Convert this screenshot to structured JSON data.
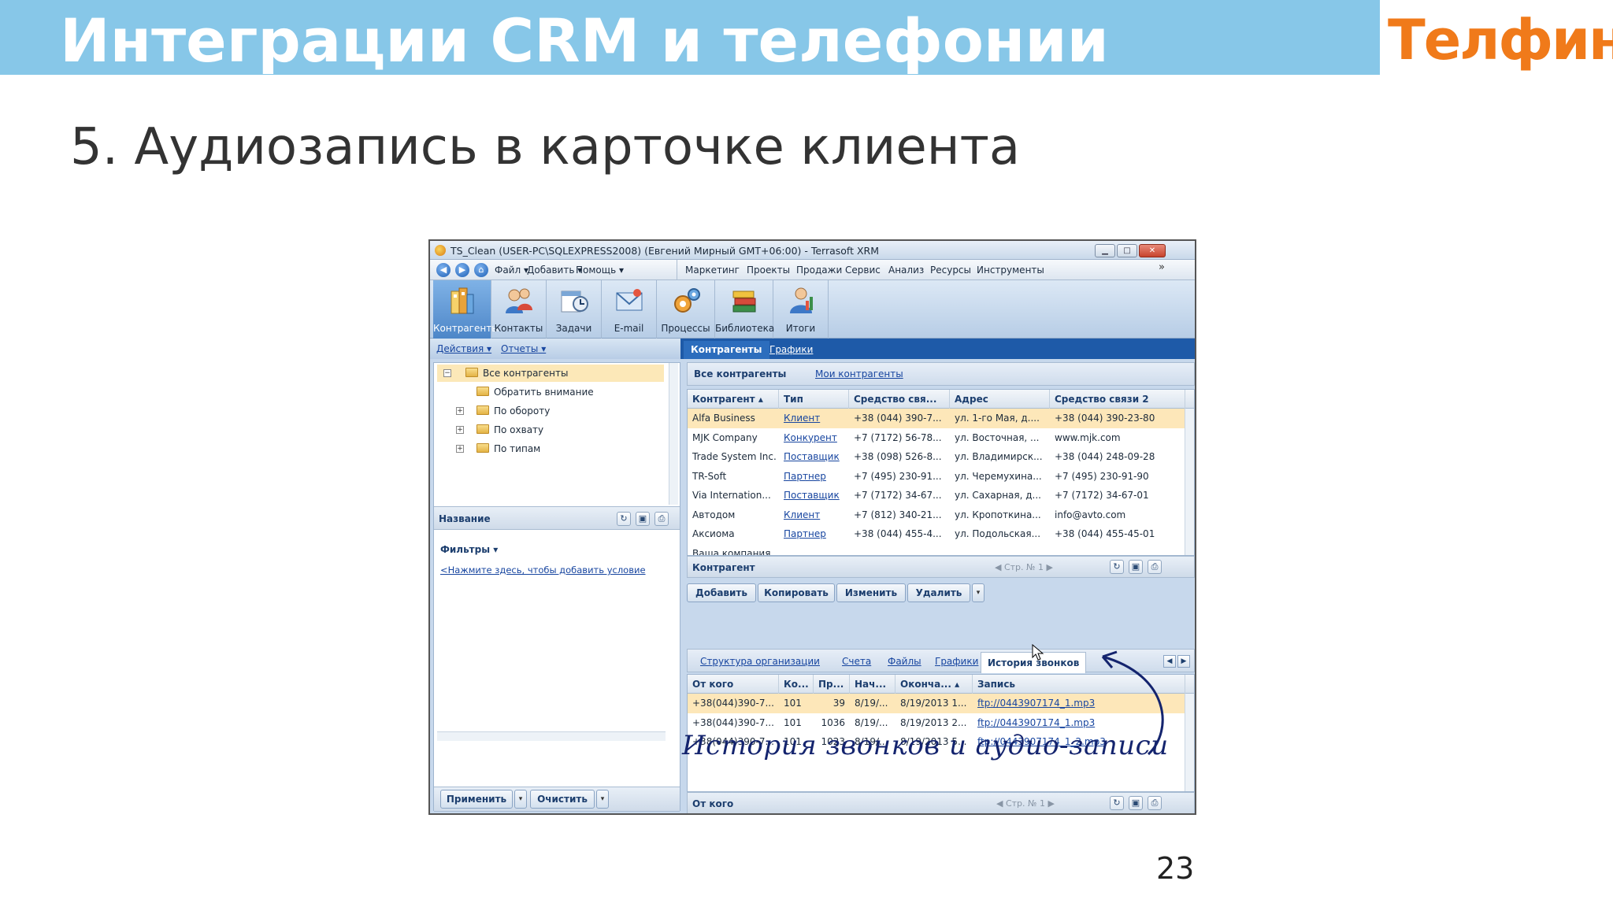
{
  "slide": {
    "banner_title": "Интеграции CRM и телефонии",
    "logo_text": "Телфин",
    "heading": "5. Аудиозапись в карточке клиента",
    "page_number": "23",
    "handwritten_note": "История звонков и аудио-записи",
    "colors": {
      "banner": "#87c7e8",
      "logo": "#f07a1a",
      "annotation": "#14246e"
    }
  },
  "window": {
    "title": "TS_Clean (USER-PC\\SQLEXPRESS2008) (Евгений Мирный GMT+06:00) - Terrasoft XRM",
    "controls": [
      "minimize",
      "maximize",
      "close"
    ]
  },
  "menu": {
    "nav_icons": [
      "back-icon",
      "forward-icon",
      "home-icon"
    ],
    "left_items": [
      "Файл",
      "Добавить",
      "Помощь"
    ],
    "right_items": [
      "Маркетинг",
      "Проекты",
      "Продажи",
      "Сервис",
      "Анализ",
      "Ресурсы",
      "Инструменты"
    ],
    "more": "»"
  },
  "ribbon": {
    "items": [
      {
        "label": "Контрагенты",
        "icon": "accounts-icon"
      },
      {
        "label": "Контакты",
        "icon": "contacts-icon"
      },
      {
        "label": "Задачи",
        "icon": "tasks-icon"
      },
      {
        "label": "E-mail",
        "icon": "email-icon"
      },
      {
        "label": "Процессы",
        "icon": "processes-icon"
      },
      {
        "label": "Библиотека",
        "icon": "library-icon"
      },
      {
        "label": "Итоги",
        "icon": "results-icon"
      }
    ]
  },
  "left_links": {
    "actions": "Действия",
    "reports": "Отчеты"
  },
  "main_tabs": {
    "active": "Контрагенты",
    "link": "Графики"
  },
  "tree": {
    "items": [
      {
        "label": "Все контрагенты",
        "level": 0,
        "expander": "−",
        "selected": true
      },
      {
        "label": "Обратить внимание",
        "level": 1,
        "expander": "",
        "selected": false
      },
      {
        "label": "По обороту",
        "level": 1,
        "expander": "+",
        "selected": false
      },
      {
        "label": "По охвату",
        "level": 1,
        "expander": "+",
        "selected": false
      },
      {
        "label": "По типам",
        "level": 1,
        "expander": "+",
        "selected": false
      }
    ],
    "footer_title": "Название"
  },
  "filters": {
    "title": "Фильтры",
    "add_condition": "<Нажмите здесь, чтобы добавить условие",
    "apply": "Применить",
    "clear": "Очистить"
  },
  "accounts": {
    "subtabs": {
      "active": "Все контрагенты",
      "link": "Мои контрагенты"
    },
    "columns": [
      "Контрагент",
      "Тип",
      "Средство свя...",
      "Адрес",
      "Средство связи 2"
    ],
    "rows": [
      {
        "name": "Alfa Business",
        "type": "Клиент",
        "phone": "+38 (044) 390-7...",
        "address": "ул. 1-го Мая, д....",
        "contact2": "+38 (044) 390-23-80"
      },
      {
        "name": "MJK Company",
        "type": "Конкурент",
        "phone": "+7 (7172) 56-78...",
        "address": "ул. Восточная, ...",
        "contact2": "www.mjk.com"
      },
      {
        "name": "Trade System Inc.",
        "type": "Поставщик",
        "phone": "+38 (098) 526-8...",
        "address": "ул. Владимирск...",
        "contact2": "+38 (044) 248-09-28"
      },
      {
        "name": "TR-Soft",
        "type": "Партнер",
        "phone": "+7 (495) 230-91...",
        "address": "ул. Черемухина...",
        "contact2": "+7 (495) 230-91-90"
      },
      {
        "name": "Via Internation...",
        "type": "Поставщик",
        "phone": "+7 (7172) 34-67...",
        "address": "ул. Сахарная, д...",
        "contact2": "+7 (7172) 34-67-01"
      },
      {
        "name": "Автодом",
        "type": "Клиент",
        "phone": "+7 (812) 340-21...",
        "address": "ул. Кропоткина...",
        "contact2": "info@avto.com"
      },
      {
        "name": "Аксиома",
        "type": "Партнер",
        "phone": "+38 (044) 455-4...",
        "address": "ул. Подольская...",
        "contact2": "+38 (044) 455-45-01"
      },
      {
        "name": "Ваша компания",
        "type": "",
        "phone": "",
        "address": "",
        "contact2": ""
      }
    ],
    "footer_title": "Контрагент",
    "pager": {
      "label": "Стр. №",
      "page": "1"
    },
    "actions": [
      "Добавить",
      "Копировать",
      "Изменить",
      "Удалить"
    ]
  },
  "details": {
    "tabs": [
      "Структура организации",
      "Счета",
      "Файлы",
      "Графики",
      "История звонков"
    ],
    "active_tab": "История звонков",
    "columns": [
      "От кого",
      "Ко...",
      "Пр...",
      "Нач...",
      "Оконча...",
      "Запись"
    ],
    "rows": [
      {
        "from": "+38(044)390-7...",
        "to": "101",
        "duration": "39",
        "start": "8/19/...",
        "end": "8/19/2013 1...",
        "record": "ftp://0443907174_1.mp3"
      },
      {
        "from": "+38(044)390-7...",
        "to": "101",
        "duration": "1036",
        "start": "8/19/...",
        "end": "8/19/2013 2...",
        "record": "ftp://0443907174_1.mp3"
      },
      {
        "from": "+38(044)390-7...",
        "to": "101",
        "duration": "1023",
        "start": "8/19/...",
        "end": "8/19/2013 5...",
        "record": "ftp://0443907174_1_2.mp3"
      }
    ],
    "footer_title": "От кого",
    "pager": {
      "label": "Стр. №",
      "page": "1"
    }
  }
}
